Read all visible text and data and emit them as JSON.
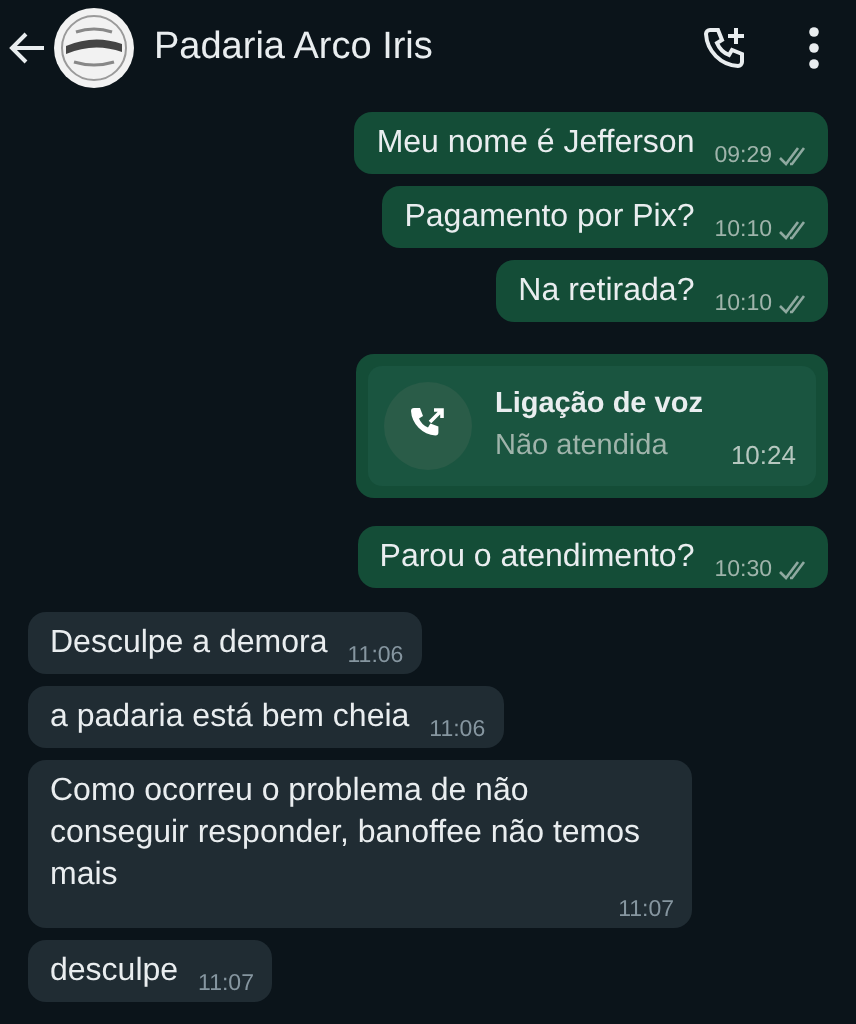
{
  "header": {
    "title": "Padaria Arco Iris"
  },
  "messages": [
    {
      "kind": "text",
      "outgoing": true,
      "text": "Meu nome é Jefferson",
      "time": "09:29"
    },
    {
      "kind": "text",
      "outgoing": true,
      "text": "Pagamento por Pix?",
      "time": "10:10"
    },
    {
      "kind": "text",
      "outgoing": true,
      "text": "Na retirada?",
      "time": "10:10"
    },
    {
      "kind": "call",
      "outgoing": true,
      "title": "Ligação de voz",
      "subtitle": "Não atendida",
      "time": "10:24"
    },
    {
      "kind": "text",
      "outgoing": true,
      "text": "Parou o atendimento?",
      "time": "10:30"
    },
    {
      "kind": "text",
      "outgoing": false,
      "text": "Desculpe a demora",
      "time": "11:06"
    },
    {
      "kind": "text",
      "outgoing": false,
      "text": "a padaria está bem cheia",
      "time": "11:06"
    },
    {
      "kind": "text",
      "outgoing": false,
      "text": "Como ocorreu o problema de não conseguir responder, banoffee não temos mais",
      "time": "11:07"
    },
    {
      "kind": "text",
      "outgoing": false,
      "text": "desculpe",
      "time": "11:07"
    }
  ]
}
